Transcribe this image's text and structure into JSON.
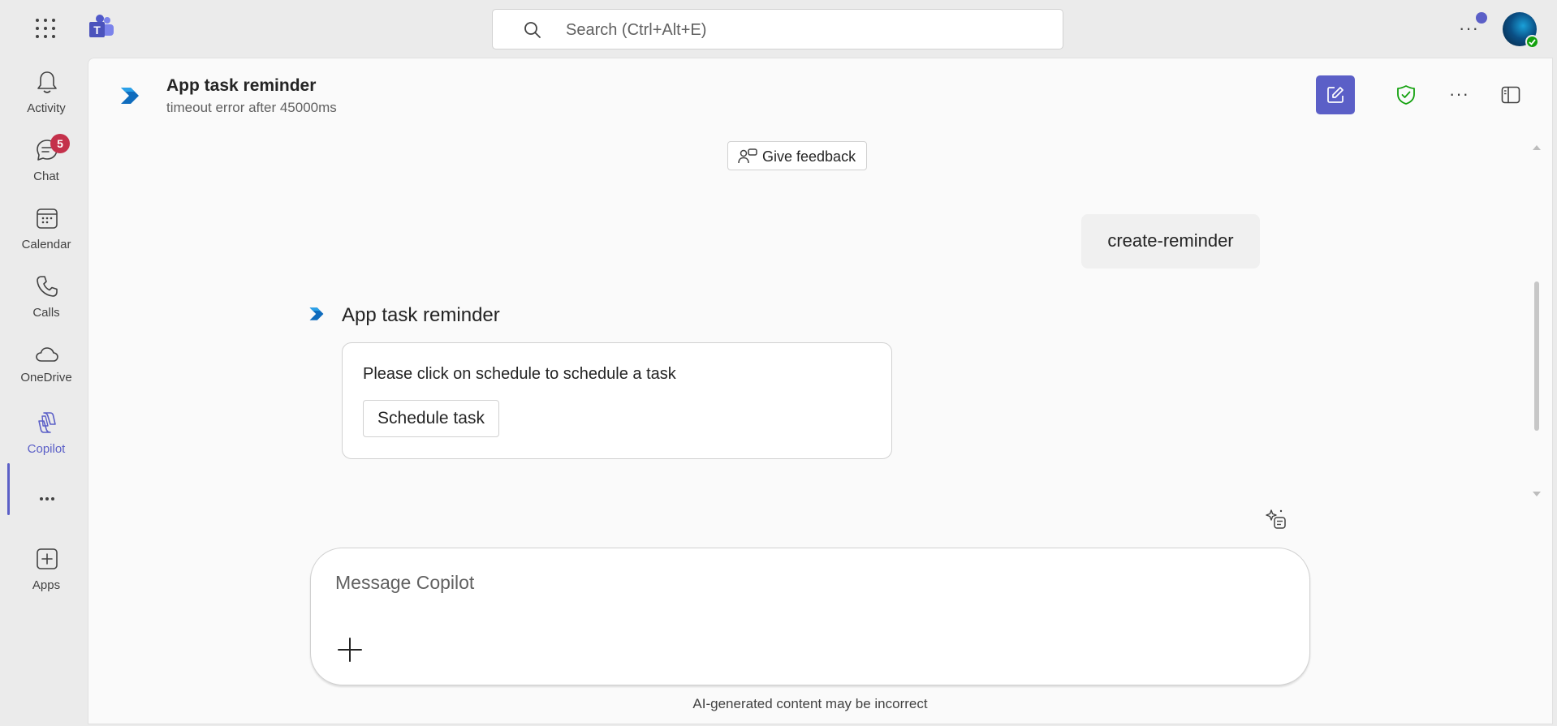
{
  "topbar": {
    "search_placeholder": "Search (Ctrl+Alt+E)",
    "app_launcher_icon": "waffle-icon",
    "more_icon": "more-horizontal-icon"
  },
  "rail": {
    "items": [
      {
        "label": "Activity",
        "icon": "bell-icon"
      },
      {
        "label": "Chat",
        "icon": "chat-icon",
        "badge": "5"
      },
      {
        "label": "Calendar",
        "icon": "calendar-icon"
      },
      {
        "label": "Calls",
        "icon": "phone-icon"
      },
      {
        "label": "OneDrive",
        "icon": "cloud-icon"
      },
      {
        "label": "Copilot",
        "icon": "copilot-icon",
        "active": true
      },
      {
        "label": "",
        "icon": "more-horizontal-icon"
      },
      {
        "label": "Apps",
        "icon": "add-app-icon"
      }
    ]
  },
  "header": {
    "title": "App task reminder",
    "subtitle": "timeout error after 45000ms"
  },
  "conversation": {
    "feedback_label": "Give feedback",
    "user_message": "create-reminder",
    "bot_name": "App task reminder",
    "card_text": "Please click on schedule to schedule a task",
    "card_button": "Schedule task"
  },
  "composer": {
    "placeholder": "Message Copilot"
  },
  "footer": {
    "disclaimer": "AI-generated content may be incorrect"
  },
  "colors": {
    "accent": "#5b5fc7",
    "badge": "#c4314b",
    "presence": "#13a10e",
    "shield": "#13a10e"
  }
}
